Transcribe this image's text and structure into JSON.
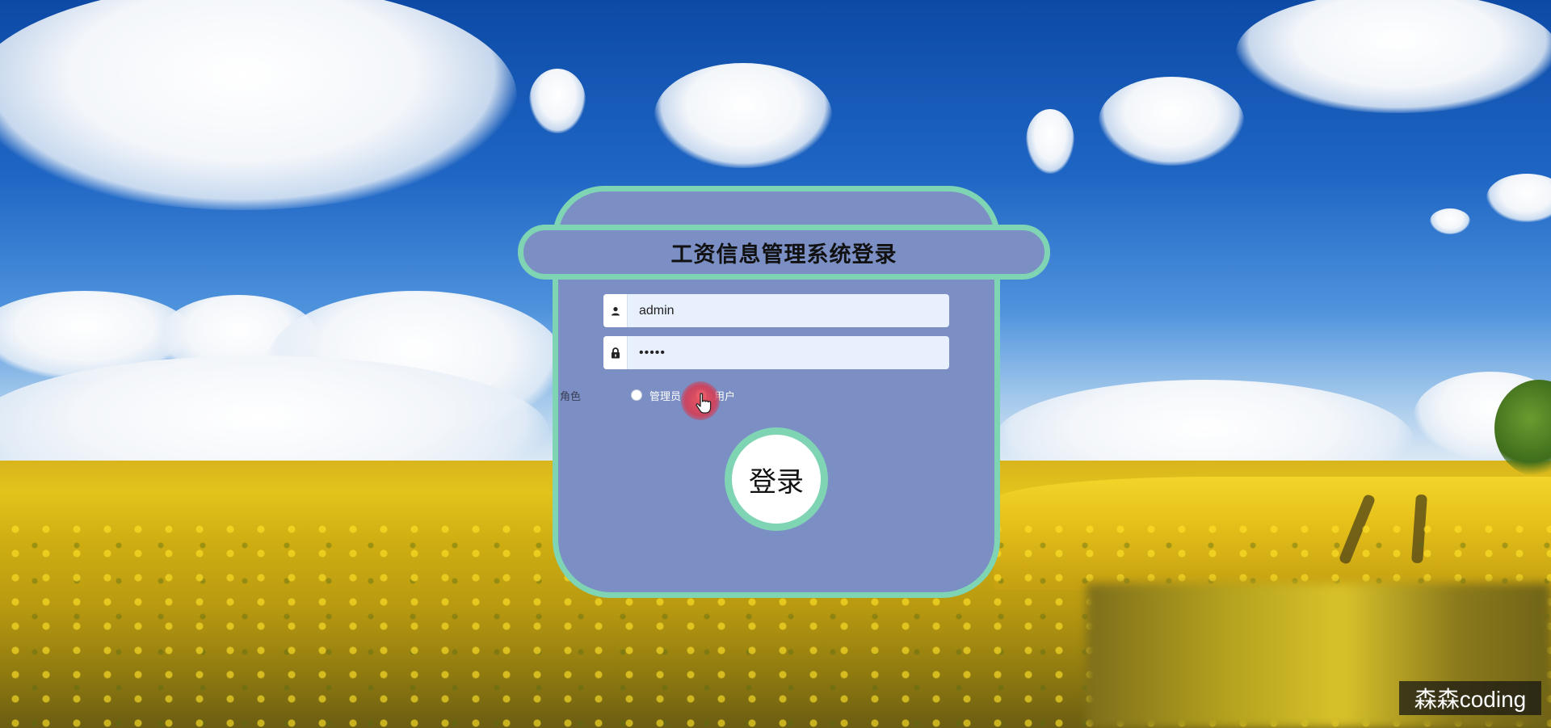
{
  "page": {
    "title": "工资信息管理系统登录"
  },
  "login_form": {
    "username_value": "admin",
    "password_value": "•••••",
    "role_label": "角色",
    "role_options": [
      "管理员",
      "用户"
    ],
    "role_selected": "用户",
    "submit_label": "登录"
  },
  "icons": {
    "username": "user-icon",
    "password": "lock-icon",
    "cursor": "hand-pointer-icon"
  },
  "colors": {
    "panel_background": "#7b8fc4",
    "panel_border": "#7fd4b4",
    "input_background": "#e8f0fe",
    "click_highlight": "#e0505e"
  },
  "watermark": {
    "text": "森森coding"
  }
}
